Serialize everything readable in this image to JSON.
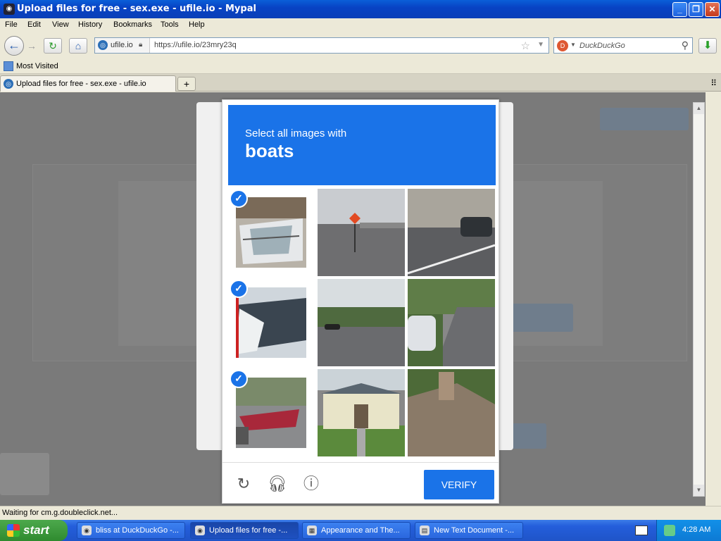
{
  "window": {
    "title": "Upload files for free - sex.exe - ufile.io - Mypal"
  },
  "menu": [
    "File",
    "Edit",
    "View",
    "History",
    "Bookmarks",
    "Tools",
    "Help"
  ],
  "urlbar": {
    "site": "ufile.io",
    "url": "https://ufile.io/23mry23q"
  },
  "search": {
    "placeholder": "DuckDuckGo"
  },
  "bookmarks": {
    "most_visited": "Most Visited"
  },
  "tab": {
    "title": "Upload files for free - sex.exe - ufile.io"
  },
  "captcha": {
    "instruction": "Select all images with",
    "target": "boats",
    "verify_label": "VERIFY",
    "tiles": [
      {
        "desc": "boat-deck",
        "selected": true
      },
      {
        "desc": "road-sign-bridge",
        "selected": false
      },
      {
        "desc": "street-car",
        "selected": false
      },
      {
        "desc": "boat-hull",
        "selected": true
      },
      {
        "desc": "road-trees",
        "selected": false
      },
      {
        "desc": "suburban-street-car",
        "selected": false
      },
      {
        "desc": "boat-trailer",
        "selected": true
      },
      {
        "desc": "house-front",
        "selected": false
      },
      {
        "desc": "roof",
        "selected": false
      }
    ]
  },
  "status": "Waiting for cm.g.doubleclick.net...",
  "taskbar": {
    "start": "start",
    "tasks": [
      "bliss at DuckDuckGo -...",
      "Upload files for free -...",
      "Appearance and The...",
      "New Text Document -..."
    ],
    "clock": "4:28 AM"
  }
}
